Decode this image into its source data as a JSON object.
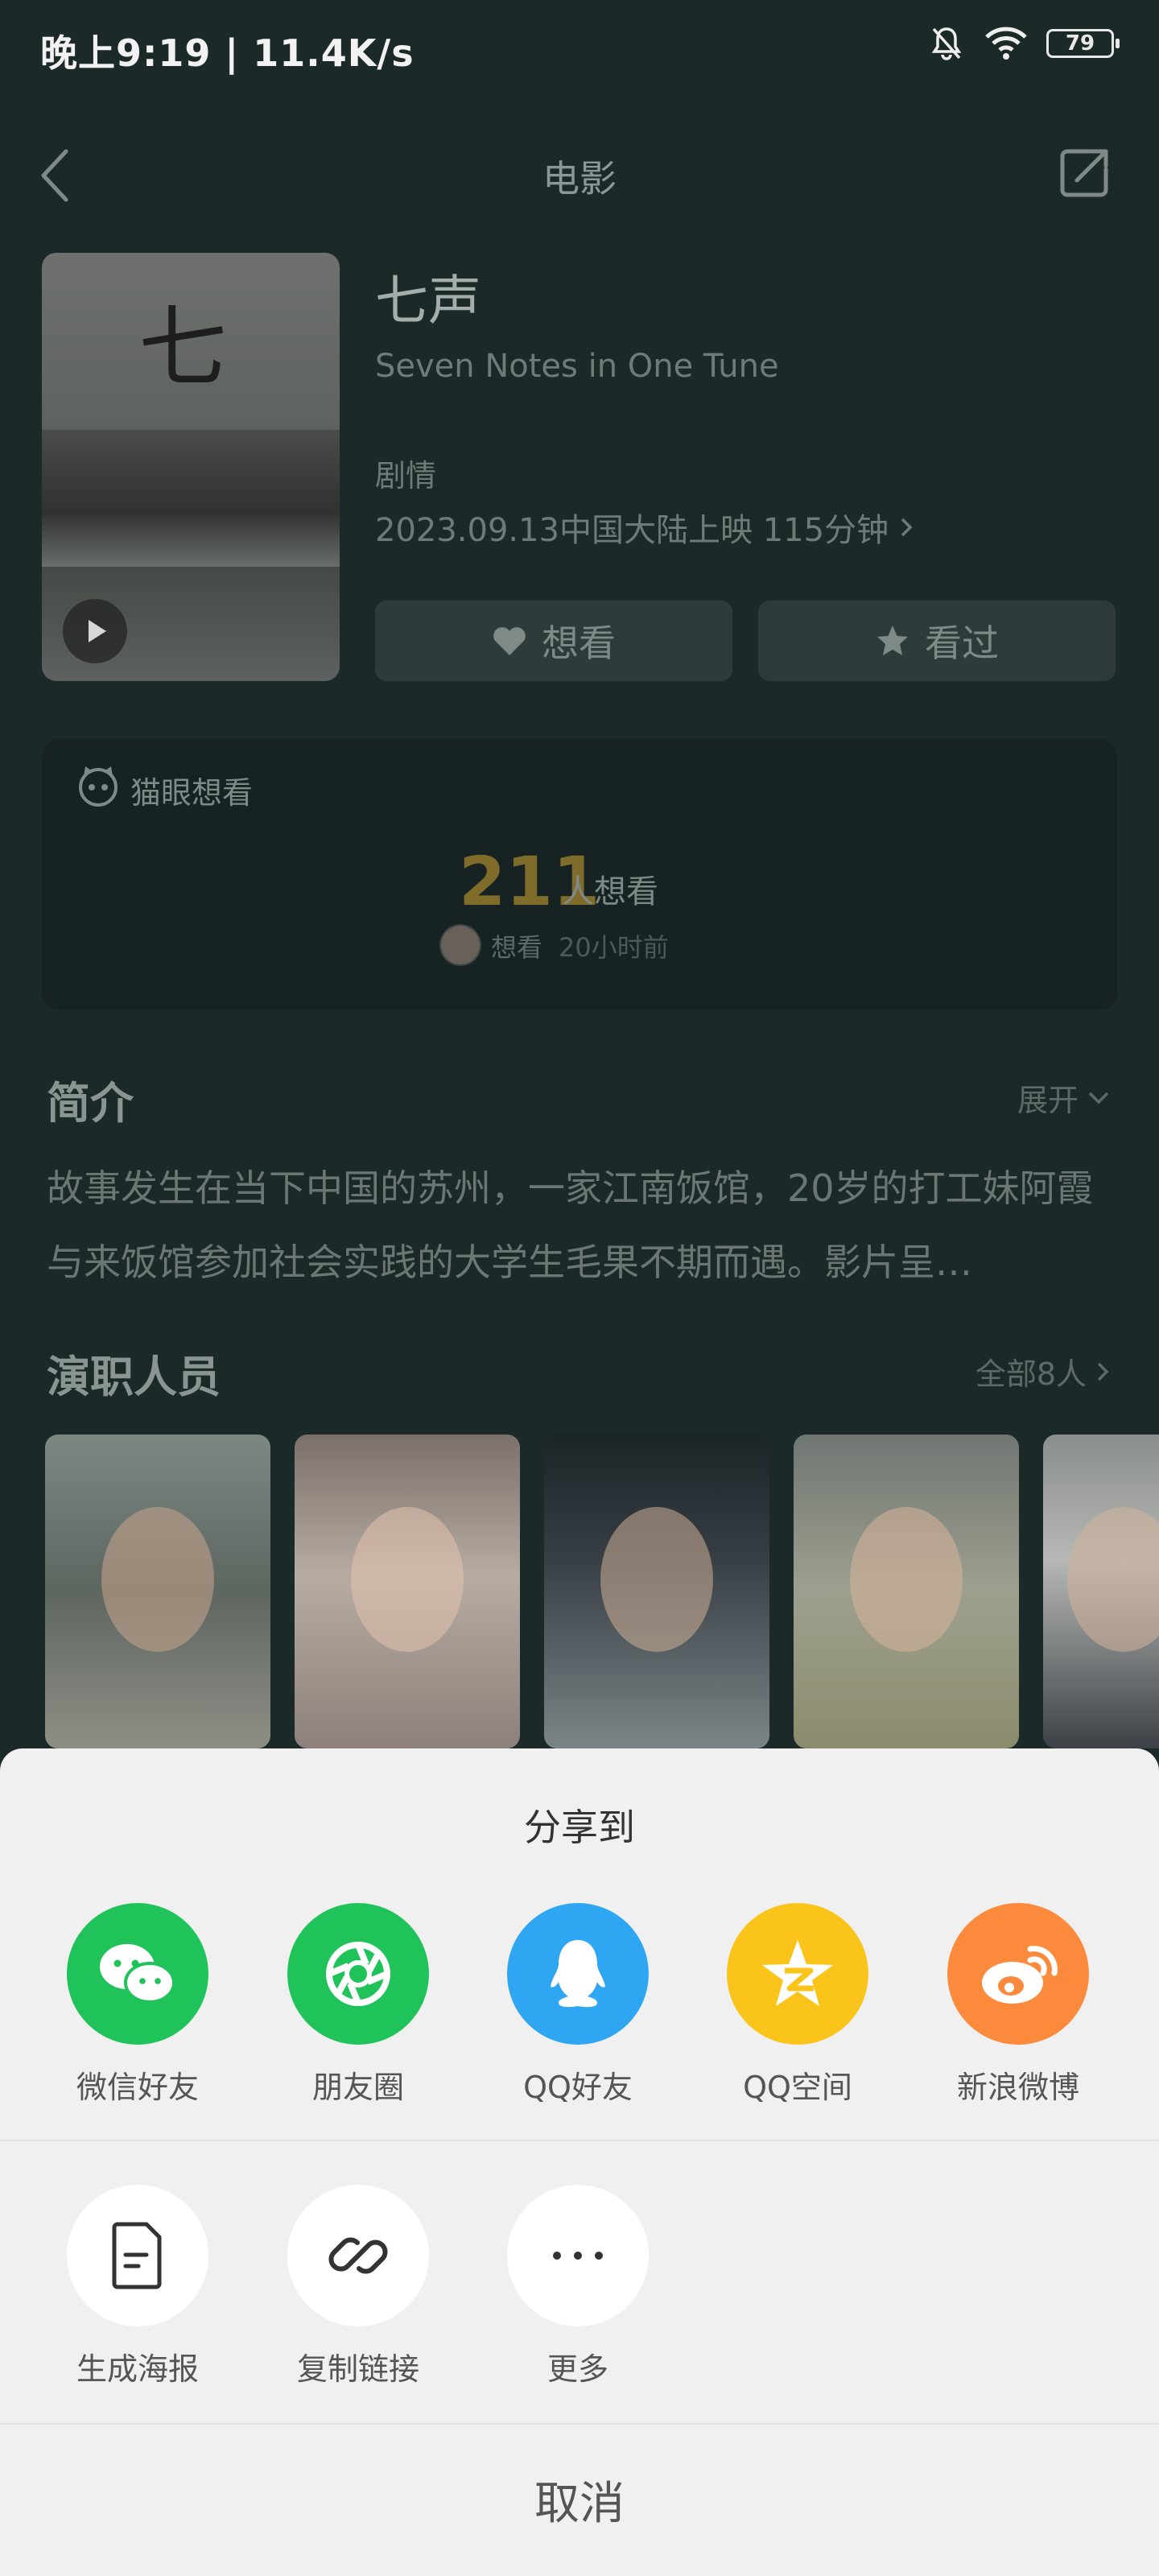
{
  "status": {
    "time": "晚上9:19 | 11.4K/s",
    "battery": "79"
  },
  "header": {
    "title": "电影"
  },
  "movie": {
    "title": "七声",
    "english_title": "Seven Notes in One Tune",
    "genre": "剧情",
    "release_info": "2023.09.13中国大陆上映 115分钟",
    "want_button": "想看",
    "seen_button": "看过"
  },
  "maoyan": {
    "label": "猫眼想看",
    "count": "211",
    "count_suffix": "人想看",
    "recent_action": "想看",
    "recent_time": "20小时前"
  },
  "intro": {
    "title": "简介",
    "expand": "展开",
    "text": "故事发生在当下中国的苏州，一家江南饭馆，20岁的打工妹阿霞与来饭馆参加社会实践的大学生毛果不期而遇。影片呈…"
  },
  "cast": {
    "title": "演职人员",
    "all": "全部8人"
  },
  "share_sheet": {
    "title": "分享到",
    "targets": [
      {
        "label": "微信好友",
        "color": "#20c35a"
      },
      {
        "label": "朋友圈",
        "color": "#20c35a"
      },
      {
        "label": "QQ好友",
        "color": "#2fa6f2"
      },
      {
        "label": "QQ空间",
        "color": "#fbc41a"
      },
      {
        "label": "新浪微博",
        "color": "#fb8a3c"
      }
    ],
    "actions": [
      {
        "label": "生成海报"
      },
      {
        "label": "复制链接"
      },
      {
        "label": "更多"
      }
    ],
    "cancel": "取消"
  }
}
